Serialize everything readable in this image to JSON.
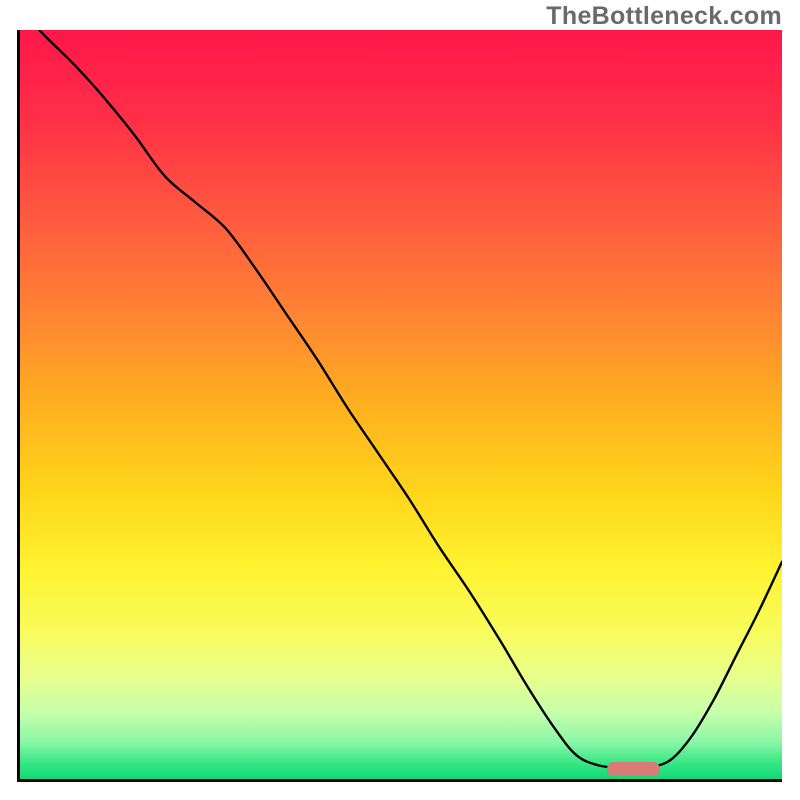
{
  "watermark": "TheBottleneck.com",
  "chart_data": {
    "type": "line",
    "title": "",
    "xlabel": "",
    "ylabel": "",
    "xlim": [
      0,
      100
    ],
    "ylim": [
      0,
      100
    ],
    "x": [
      0,
      3,
      7,
      11,
      15,
      19,
      23,
      27,
      31,
      35,
      39,
      43,
      47,
      51,
      55,
      59,
      63,
      66.5,
      70,
      73,
      76,
      79,
      81.5,
      85,
      88,
      91,
      94,
      97,
      100
    ],
    "values": [
      103,
      99.5,
      95.5,
      91,
      86,
      80.5,
      77,
      73.5,
      68,
      62,
      56,
      49.5,
      43.5,
      37.5,
      31,
      25,
      18.5,
      12.5,
      7,
      3.2,
      1.8,
      1.5,
      1.5,
      2.3,
      5.5,
      10.5,
      16.5,
      22.5,
      29
    ],
    "marker": {
      "x_start": 77,
      "x_end": 84,
      "y": 1.4
    },
    "gradient_stops": [
      {
        "pct": 0,
        "color": "#ff174a"
      },
      {
        "pct": 12,
        "color": "#ff2f47"
      },
      {
        "pct": 25,
        "color": "#ff5a3f"
      },
      {
        "pct": 38,
        "color": "#ff8433"
      },
      {
        "pct": 50,
        "color": "#ffb01f"
      },
      {
        "pct": 62,
        "color": "#ffd61a"
      },
      {
        "pct": 72,
        "color": "#fff332"
      },
      {
        "pct": 80,
        "color": "#f9fb5a"
      },
      {
        "pct": 86,
        "color": "#eaff8a"
      },
      {
        "pct": 91,
        "color": "#c9ffab"
      },
      {
        "pct": 95,
        "color": "#8bf7a8"
      },
      {
        "pct": 98,
        "color": "#34e683"
      },
      {
        "pct": 100,
        "color": "#10d977"
      }
    ]
  }
}
